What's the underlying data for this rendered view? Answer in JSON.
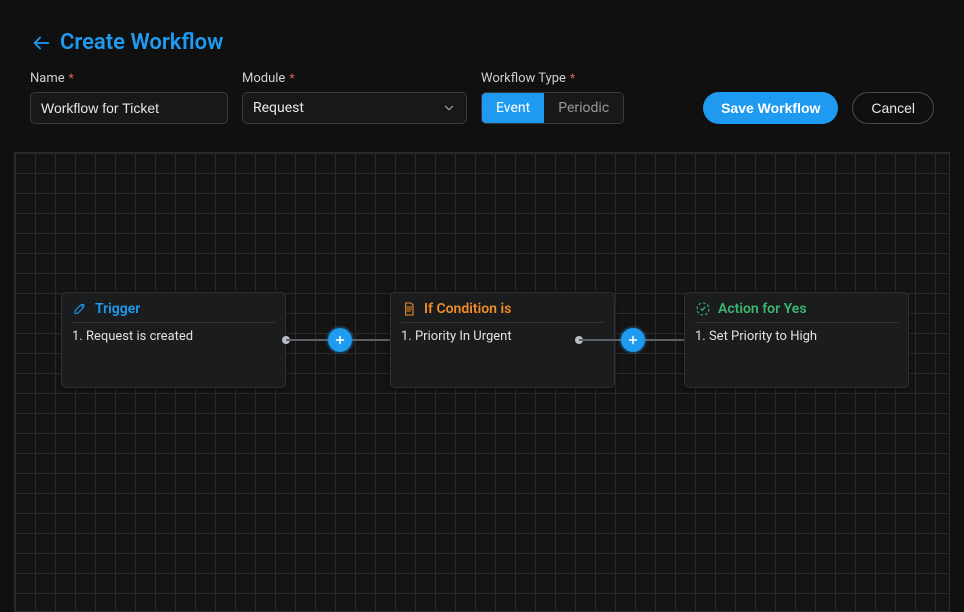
{
  "header": {
    "title": "Create Workflow"
  },
  "form": {
    "name": {
      "label": "Name",
      "value": "Workflow for Ticket"
    },
    "module": {
      "label": "Module",
      "value": "Request"
    },
    "type": {
      "label": "Workflow Type",
      "options": [
        "Event",
        "Periodic"
      ],
      "active": "Event"
    },
    "save_label": "Save Workflow",
    "cancel_label": "Cancel"
  },
  "nodes": {
    "trigger": {
      "title": "Trigger",
      "item": "1. Request is created"
    },
    "condition": {
      "title": "If Condition is",
      "item": "1. Priority In Urgent"
    },
    "action": {
      "title": "Action for Yes",
      "item": "1. Set Priority to High"
    }
  }
}
